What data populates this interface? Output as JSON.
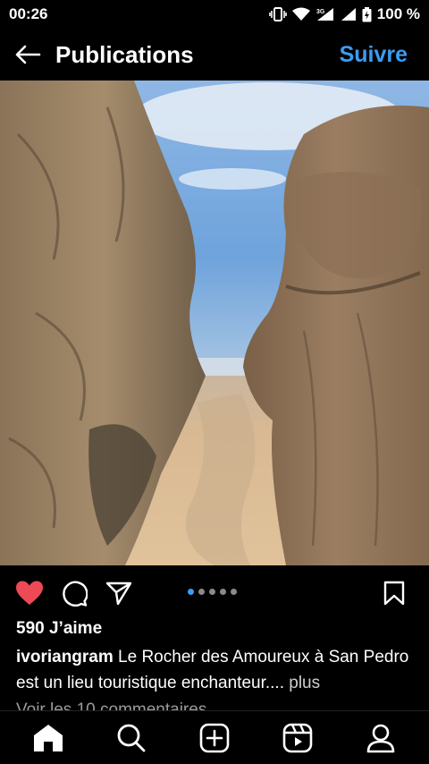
{
  "status_bar": {
    "time": "00:26",
    "network": "3G",
    "battery": "100 %"
  },
  "header": {
    "title": "Publications",
    "follow_label": "Suivre",
    "back_icon": "arrow-left-icon"
  },
  "post": {
    "image_alt": "Le Rocher des Amoureux à San Pedro",
    "carousel": {
      "count": 5,
      "active": 1
    },
    "likes": "590 J’aime",
    "username": "ivoriangram",
    "caption_text": "Le Rocher des Amoureux à San Pedro est un lieu touristique enchanteur....",
    "more_label": "plus",
    "comments_link": "Voir les 10 commentaires",
    "liked": true,
    "colors": {
      "heart": "#ed4956",
      "accent": "#3a9cf2"
    }
  },
  "bottom_nav": {
    "items": [
      {
        "name": "home",
        "icon": "home-icon"
      },
      {
        "name": "search",
        "icon": "search-icon"
      },
      {
        "name": "create",
        "icon": "plus-square-icon"
      },
      {
        "name": "reels",
        "icon": "reels-icon"
      },
      {
        "name": "profile",
        "icon": "profile-icon"
      }
    ]
  }
}
